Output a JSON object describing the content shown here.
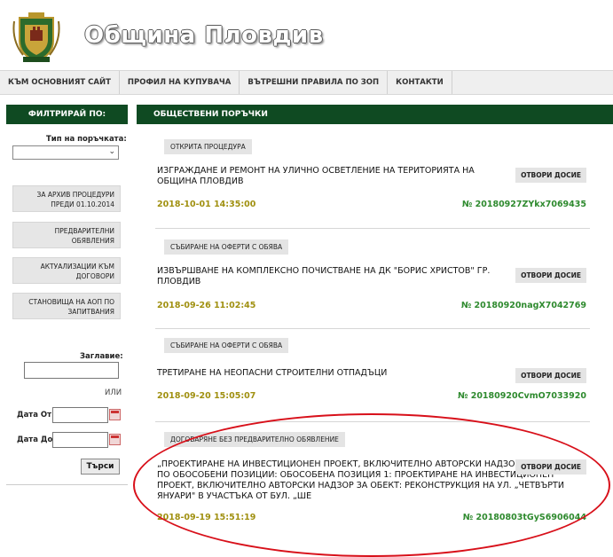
{
  "header": {
    "site_title": "Община Пловдив"
  },
  "nav": [
    "КЪМ ОСНОВНИЯТ САЙТ",
    "ПРОФИЛ НА КУПУВАЧА",
    "ВЪТРЕШНИ ПРАВИЛА ПО ЗОП",
    "КОНТАКТИ"
  ],
  "sidebar": {
    "title": "ФИЛТРИРАЙ ПО:",
    "type_label": "Тип на поръчката:",
    "type_value": "",
    "buttons": [
      "ЗА АРХИВ ПРОЦЕДУРИ ПРЕДИ 01.10.2014",
      "ПРЕДВАРИТЕЛНИ ОБЯВЛЕНИЯ",
      "АКТУАЛИЗАЦИИ КЪМ ДОГОВОРИ",
      "СТАНОВИЩА НА АОП ПО ЗАПИТВАНИЯ"
    ],
    "title_label": "Заглавие:",
    "or_label": "ИЛИ",
    "date_from_label": "Дата От:",
    "date_to_label": "Дата До:",
    "search_button": "Търси"
  },
  "main": {
    "title": "ОБЩЕСТВЕНИ ПОРЪЧКИ",
    "dossier_label": "ОТВОРИ ДОСИЕ",
    "items": [
      {
        "tag": "ОТКРИТА ПРОЦЕДУРА",
        "title": "ИЗГРАЖДАНЕ И РЕМОНТ НА УЛИЧНО ОСВЕТЛЕНИЕ НА ТЕРИТОРИЯТА НА ОБЩИНА ПЛОВДИВ",
        "date": "2018-10-01 14:35:00",
        "ref": "№ 20180927ZYkx7069435"
      },
      {
        "tag": "СЪБИРАНЕ НА ОФЕРТИ С ОБЯВА",
        "title": "ИЗВЪРШВАНЕ НА КОМПЛЕКСНО ПОЧИСТВАНЕ НА ДК \"БОРИС ХРИСТОВ\" ГР. ПЛОВДИВ",
        "date": "2018-09-26 11:02:45",
        "ref": "№ 20180920nagX7042769"
      },
      {
        "tag": "СЪБИРАНЕ НА ОФЕРТИ С ОБЯВА",
        "title": "ТРЕТИРАНЕ НА НЕОПАСНИ СТРОИТЕЛНИ ОТПАДЪЦИ",
        "date": "2018-09-20 15:05:07",
        "ref": "№ 20180920CvmO7033920"
      },
      {
        "tag": "ДОГОВАРЯНЕ БЕЗ ПРЕДВАРИТЕЛНО ОБЯВЛЕНИЕ",
        "title": "„ПРОЕКТИРАНЕ НА ИНВЕСТИЦИОНЕН ПРОЕКТ, ВКЛЮЧИТЕЛНО АВТОРСКИ НАДЗОР ЗА ОБЕКТИ ПО ОБОСОБЕНИ ПОЗИЦИИ: ОБОСОБЕНА ПОЗИЦИЯ 1: ПРОЕКТИРАНЕ НА ИНВЕСТИЦИОНЕН ПРОЕКТ, ВКЛЮЧИТЕЛНО АВТОРСКИ НАДЗОР ЗА ОБЕКТ: РЕКОНСТРУКЦИЯ НА УЛ. „ЧЕТВЪРТИ ЯНУАРИ\" В УЧАСТЪКА ОТ БУЛ. „ШЕ",
        "date": "2018-09-19 15:51:19",
        "ref": "№ 20180803tGyS6906044"
      }
    ]
  },
  "colors": {
    "header_green": "#0f4a22",
    "date_color": "#a09010",
    "ref_color": "#2e8a2e",
    "highlight": "#d8101a"
  }
}
